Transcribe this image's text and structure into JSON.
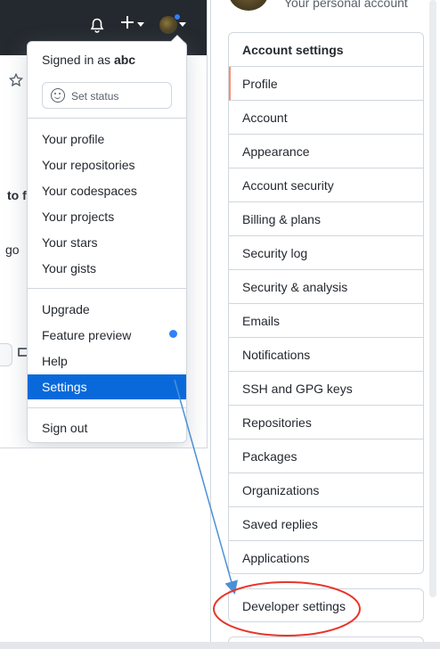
{
  "dropdown": {
    "signed_in_prefix": "Signed in as ",
    "username": "abc",
    "set_status": "Set status",
    "items_group1": [
      "Your profile",
      "Your repositories",
      "Your codespaces",
      "Your projects",
      "Your stars",
      "Your gists"
    ],
    "items_group2": [
      "Upgrade",
      "Feature preview",
      "Help",
      "Settings"
    ],
    "sign_out": "Sign out",
    "selected_item": "Settings"
  },
  "background": {
    "partial_text_1": "to f",
    "partial_text_2": "go"
  },
  "settings_panel": {
    "personal_account_caption": "Your personal account",
    "header": "Account settings",
    "active_item": "Profile",
    "items": [
      "Profile",
      "Account",
      "Appearance",
      "Account security",
      "Billing & plans",
      "Security log",
      "Security & analysis",
      "Emails",
      "Notifications",
      "SSH and GPG keys",
      "Repositories",
      "Packages",
      "Organizations",
      "Saved replies",
      "Applications"
    ],
    "developer_settings": "Developer settings"
  },
  "icons": {
    "notifications": "bell-icon",
    "create_new": "plus-icon",
    "user_avatar": "avatar",
    "status": "smiley-icon",
    "star": "star-icon"
  },
  "colors": {
    "header_bg": "#24292f",
    "selected_bg": "#0969da",
    "notification_dot": "#2f81f7",
    "active_indicator": "#fd8c73",
    "annotation_arrow": "#4a90d9",
    "annotation_circle": "#e8352a"
  }
}
